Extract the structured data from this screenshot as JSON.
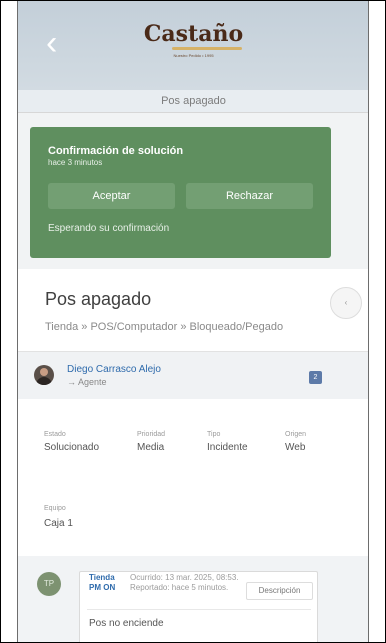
{
  "header": {
    "brand": "Castaño",
    "brand_tagline": "Nuestro Pedido • 1995",
    "back_icon": "chevron-left-icon",
    "subtitle": "Pos apagado"
  },
  "confirmation": {
    "title": "Confirmación de solución",
    "time": "hace 3 minutos",
    "accept_label": "Aceptar",
    "reject_label": "Rechazar",
    "waiting_text": "Esperando su confirmación",
    "color": "#5f8f5f"
  },
  "ticket": {
    "title": "Pos apagado",
    "breadcrumb": "Tienda » POS/Computador » Bloqueado/Pegado",
    "side_button": "‹"
  },
  "agent": {
    "name": "Diego Carrasco Alejo",
    "role": "→ Agente",
    "count": "2"
  },
  "details": [
    {
      "label": "Estado",
      "value": "Solucionado"
    },
    {
      "label": "Prioridad",
      "value": "Media"
    },
    {
      "label": "Tipo",
      "value": "Incidente"
    },
    {
      "label": "Origen",
      "value": "Web"
    }
  ],
  "team": {
    "label": "Equipo",
    "value": "Caja 1"
  },
  "comment": {
    "avatar_initials": "TP",
    "author": "Tienda PM ON",
    "meta": "Ocurrido: 13 mar. 2025, 08:53. Reportado: hace 5 minutos.",
    "description_button": "Descripción",
    "text": "Pos no enciende"
  }
}
